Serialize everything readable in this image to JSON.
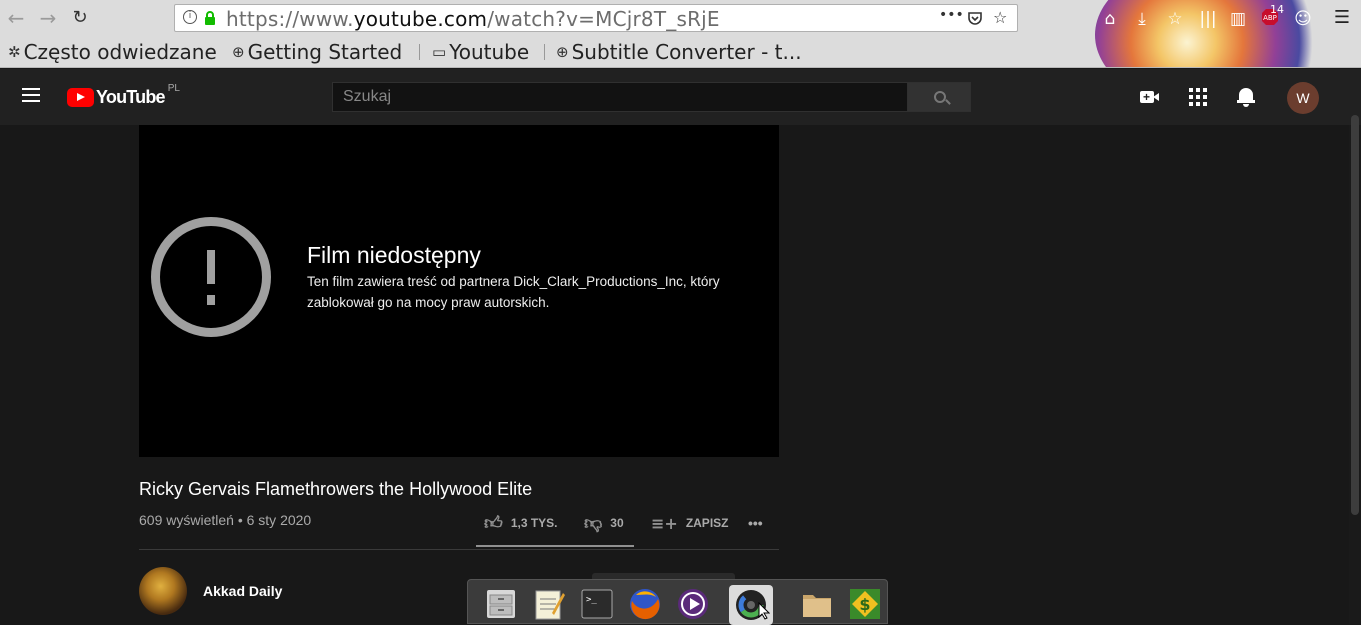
{
  "browser": {
    "url_prefix": "https://www.",
    "url_domain": "youtube.com",
    "url_path": "/watch?v=MCjr8T_sRjE",
    "page_actions": "•••",
    "abp_count": "14",
    "bookmarks": [
      {
        "label": "Często odwiedzane",
        "icon": "gear-icon"
      },
      {
        "label": "Getting Started",
        "icon": "globe-icon"
      },
      {
        "label": "Youtube",
        "icon": "folder-icon"
      },
      {
        "label": "Subtitle Converter - t...",
        "icon": "globe-icon"
      }
    ]
  },
  "youtube": {
    "logo_text": "YouTube",
    "country": "PL",
    "search_placeholder": "Szukaj",
    "avatar_letter": "W",
    "player": {
      "title": "Film niedostępny",
      "message": "Ten film zawiera treść od partnera Dick_Clark_Productions_Inc, który zablokował go na mocy praw autorskich."
    },
    "video": {
      "title": "Ricky Gervais Flamethrowers the Hollywood Elite",
      "meta": "609 wyświetleń • 6 sty 2020",
      "likes": "1,3 TYS.",
      "dislikes": "30",
      "save": "ZAPISZ",
      "more": "•••"
    },
    "channel": {
      "name": "Akkad Daily"
    }
  },
  "dock": {
    "items": [
      "file-cabinet-icon",
      "text-editor-icon",
      "terminal-icon",
      "firefox-icon",
      "media-player-icon",
      "disk-usage-icon",
      "folder-icon",
      "money-manager-icon"
    ]
  }
}
